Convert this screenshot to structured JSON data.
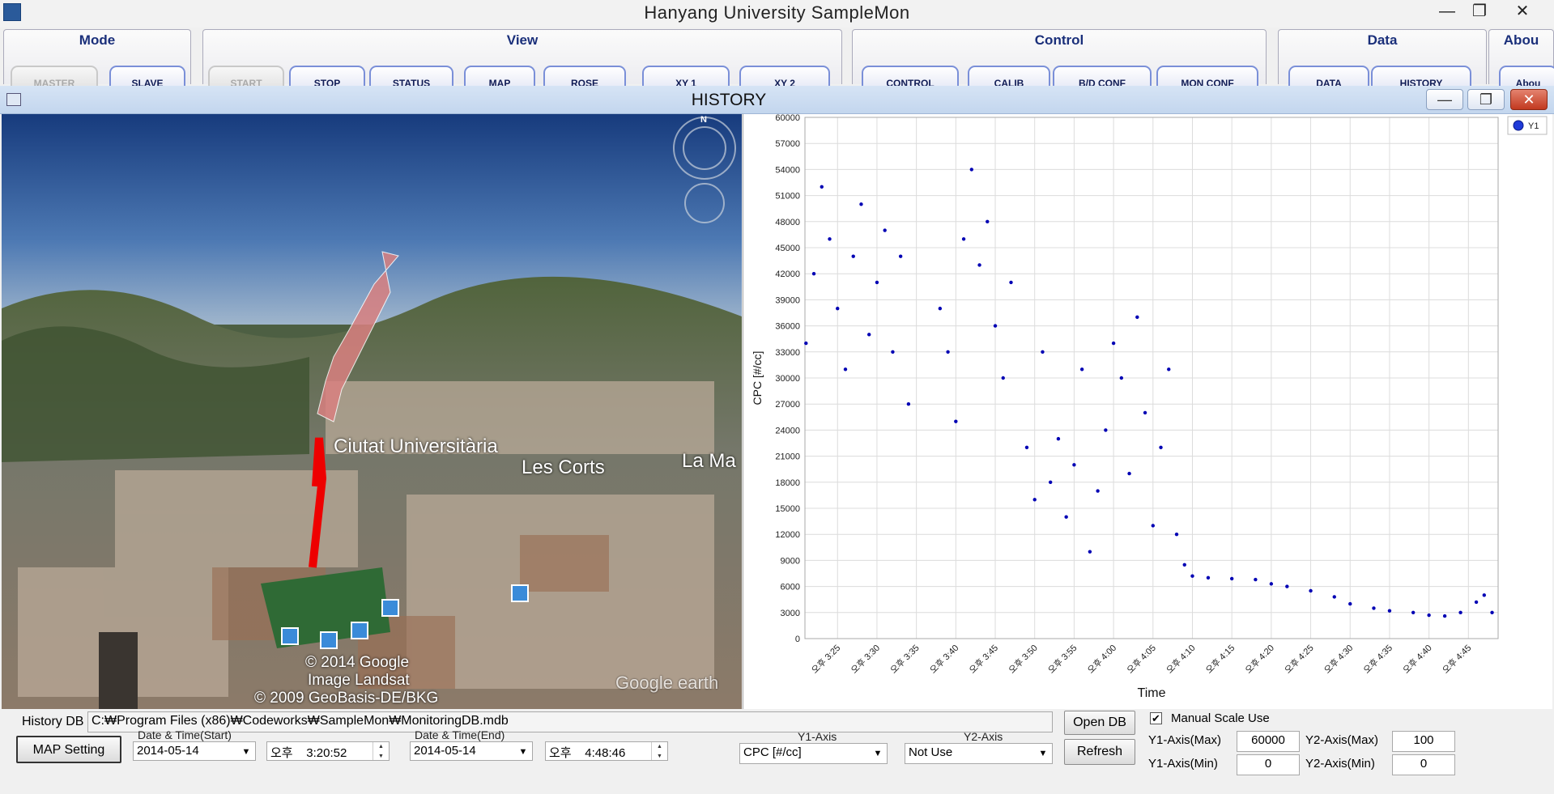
{
  "window": {
    "title": "Hanyang University SampleMon",
    "minimize": "—",
    "maximize": "❐",
    "close": "✕"
  },
  "ribbon": {
    "mode": {
      "title": "Mode",
      "buttons": [
        "MASTER",
        "SLAVE"
      ]
    },
    "view": {
      "title": "View",
      "buttons": [
        "START",
        "STOP",
        "STATUS",
        "MAP",
        "ROSE",
        "XY 1",
        "XY 2"
      ]
    },
    "control": {
      "title": "Control",
      "buttons": [
        "CONTROL",
        "CALIB",
        "B/D CONF",
        "MON CONF"
      ]
    },
    "data": {
      "title": "Data",
      "buttons": [
        "DATA",
        "HISTORY"
      ]
    },
    "about": {
      "title": "Abou",
      "buttons": [
        "Abou"
      ]
    }
  },
  "child": {
    "title": "HISTORY",
    "minimize": "—",
    "restore": "❐",
    "close": "✕"
  },
  "map": {
    "labels": [
      "Ciutat Universitària",
      "Les Corts",
      "La Ma"
    ],
    "copyright": [
      "© 2014 Google",
      "Image Landsat",
      "© 2009 GeoBasis-DE/BKG"
    ],
    "watermark": "Google earth",
    "compass": "N"
  },
  "chart_data": {
    "type": "scatter",
    "ylabel": "CPC [#/cc]",
    "xlabel": "Time",
    "ylim": [
      0,
      60000
    ],
    "yticks": [
      "0",
      "3000",
      "6000",
      "9000",
      "12000",
      "15000",
      "18000",
      "21000",
      "24000",
      "27000",
      "30000",
      "33000",
      "36000",
      "39000",
      "42000",
      "45000",
      "48000",
      "51000",
      "54000",
      "57000",
      "60000"
    ],
    "xticks": [
      "오후 3:25",
      "오후 3:30",
      "오후 3:35",
      "오후 3:40",
      "오후 3:45",
      "오후 3:50",
      "오후 3:55",
      "오후 4:00",
      "오후 4:05",
      "오후 4:10",
      "오후 4:15",
      "오후 4:20",
      "오후 4:25",
      "오후 4:30",
      "오후 4:35",
      "오후 4:40",
      "오후 4:45"
    ],
    "xrange": [
      "15:20:52",
      "16:48:46"
    ],
    "series": [
      {
        "name": "Y1",
        "color": "#0000b4",
        "points": [
          [
            "15:21",
            34000
          ],
          [
            "15:22",
            42000
          ],
          [
            "15:23",
            52000
          ],
          [
            "15:24",
            46000
          ],
          [
            "15:25",
            38000
          ],
          [
            "15:26",
            31000
          ],
          [
            "15:27",
            44000
          ],
          [
            "15:28",
            50000
          ],
          [
            "15:29",
            35000
          ],
          [
            "15:30",
            41000
          ],
          [
            "15:31",
            47000
          ],
          [
            "15:32",
            33000
          ],
          [
            "15:33",
            44000
          ],
          [
            "15:34",
            27000
          ],
          [
            "15:38",
            38000
          ],
          [
            "15:39",
            33000
          ],
          [
            "15:40",
            25000
          ],
          [
            "15:41",
            46000
          ],
          [
            "15:42",
            54000
          ],
          [
            "15:43",
            43000
          ],
          [
            "15:44",
            48000
          ],
          [
            "15:45",
            36000
          ],
          [
            "15:46",
            30000
          ],
          [
            "15:47",
            41000
          ],
          [
            "15:49",
            22000
          ],
          [
            "15:50",
            16000
          ],
          [
            "15:51",
            33000
          ],
          [
            "15:52",
            18000
          ],
          [
            "15:53",
            23000
          ],
          [
            "15:54",
            14000
          ],
          [
            "15:55",
            20000
          ],
          [
            "15:56",
            31000
          ],
          [
            "15:57",
            10000
          ],
          [
            "15:58",
            17000
          ],
          [
            "15:59",
            24000
          ],
          [
            "16:00",
            34000
          ],
          [
            "16:01",
            30000
          ],
          [
            "16:02",
            19000
          ],
          [
            "16:03",
            37000
          ],
          [
            "16:04",
            26000
          ],
          [
            "16:05",
            13000
          ],
          [
            "16:06",
            22000
          ],
          [
            "16:07",
            31000
          ],
          [
            "16:08",
            12000
          ],
          [
            "16:09",
            8500
          ],
          [
            "16:10",
            7200
          ],
          [
            "16:12",
            7000
          ],
          [
            "16:15",
            6900
          ],
          [
            "16:18",
            6800
          ],
          [
            "16:20",
            6300
          ],
          [
            "16:22",
            6000
          ],
          [
            "16:25",
            5500
          ],
          [
            "16:28",
            4800
          ],
          [
            "16:30",
            4000
          ],
          [
            "16:33",
            3500
          ],
          [
            "16:35",
            3200
          ],
          [
            "16:38",
            3000
          ],
          [
            "16:40",
            2700
          ],
          [
            "16:42",
            2600
          ],
          [
            "16:44",
            3000
          ],
          [
            "16:46",
            4200
          ],
          [
            "16:47",
            5000
          ],
          [
            "16:48",
            3000
          ]
        ]
      }
    ]
  },
  "bottom": {
    "history_db_label": "History DB",
    "history_db_path": "C:₩Program Files (x86)₩Codeworks₩SampleMon₩MonitoringDB.mdb",
    "open_db": "Open DB",
    "refresh": "Refresh",
    "map_setting": "MAP Setting",
    "start_label": "Date & Time(Start)",
    "start_date": "2014-05-14",
    "start_ampm": "오후",
    "start_time": "3:20:52",
    "end_label": "Date & Time(End)",
    "end_date": "2014-05-14",
    "end_ampm": "오후",
    "end_time": "4:48:46",
    "y1_axis_label": "Y1-Axis",
    "y1_axis_value": "CPC [#/cc]",
    "y2_axis_label": "Y2-Axis",
    "y2_axis_value": "Not Use",
    "manual_scale": "Manual Scale Use",
    "manual_scale_checked": true,
    "y1_max_label": "Y1-Axis(Max)",
    "y1_max": "60000",
    "y1_min_label": "Y1-Axis(Min)",
    "y1_min": "0",
    "y2_max_label": "Y2-Axis(Max)",
    "y2_max": "100",
    "y2_min_label": "Y2-Axis(Min)",
    "y2_min": "0"
  }
}
